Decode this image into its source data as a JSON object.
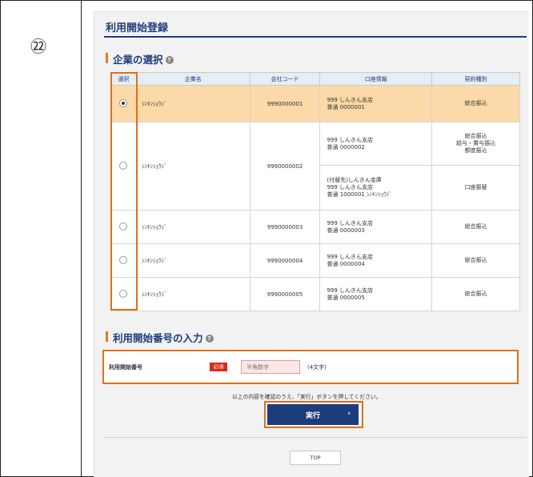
{
  "step_number": "㉒",
  "page_title": "利用開始登録",
  "section_company": {
    "heading": "企業の選択",
    "help_icon": "?"
  },
  "table": {
    "headers": [
      "選択",
      "企業名",
      "会社コード",
      "口座情報",
      "契約種別"
    ],
    "rows": [
      {
        "selected": true,
        "name": "ｼﾝｷﾝｼｮｳｼﾞ",
        "code": "9990000001",
        "account_lines": [
          "999 しんきん支店",
          "普通 0000001"
        ],
        "type_lines": [
          "総合振込"
        ]
      },
      {
        "selected": false,
        "name": "ｼﾝｷﾝｼｮｳｼﾞ",
        "code": "9990000002",
        "account_lines": [
          "999 しんきん支店",
          "普通 0000002"
        ],
        "type_lines": [
          "総合振込",
          "給与・賞与振込",
          "都度振込"
        ],
        "sub": {
          "account_lines": [
            "(付替先)しんきん金庫",
            "999 しんきん支店",
            "普通 1000001 ｼﾝｷﾝｼｮｳｼﾞ"
          ],
          "type_lines": [
            "口座振替"
          ]
        }
      },
      {
        "selected": false,
        "name": "ｼﾝｷﾝｼｮｳｼﾞ",
        "code": "9990000003",
        "account_lines": [
          "999 しんきん支店",
          "普通 0000003"
        ],
        "type_lines": [
          "総合振込"
        ]
      },
      {
        "selected": false,
        "name": "ｼﾝｷﾝｼｮｳｼﾞ",
        "code": "9990000004",
        "account_lines": [
          "999 しんきん支店",
          "普通 0000004"
        ],
        "type_lines": [
          "総合振込"
        ]
      },
      {
        "selected": false,
        "name": "ｼﾝｷﾝｼｮｳｼﾞ",
        "code": "9990000005",
        "account_lines": [
          "999 しんきん支店",
          "普通 0000005"
        ],
        "type_lines": [
          "総合振込"
        ]
      }
    ]
  },
  "section_code": {
    "heading": "利用開始番号の入力",
    "help_icon": "?"
  },
  "code_field": {
    "label": "利用開始番号",
    "required_badge": "必須",
    "placeholder": "半角数字",
    "value": "",
    "note": "(4文字)"
  },
  "confirm_text": "以上の内容を確認のうえ、「実行」ボタンを押してください。",
  "execute_button": {
    "label": "実行",
    "arrow": "›"
  },
  "top_button": "TOP",
  "colors": {
    "brand_navy": "#1d3d7a",
    "highlight_orange": "#e0701a",
    "selected_row": "#fbd9a8",
    "required_red": "#d92a1c"
  }
}
